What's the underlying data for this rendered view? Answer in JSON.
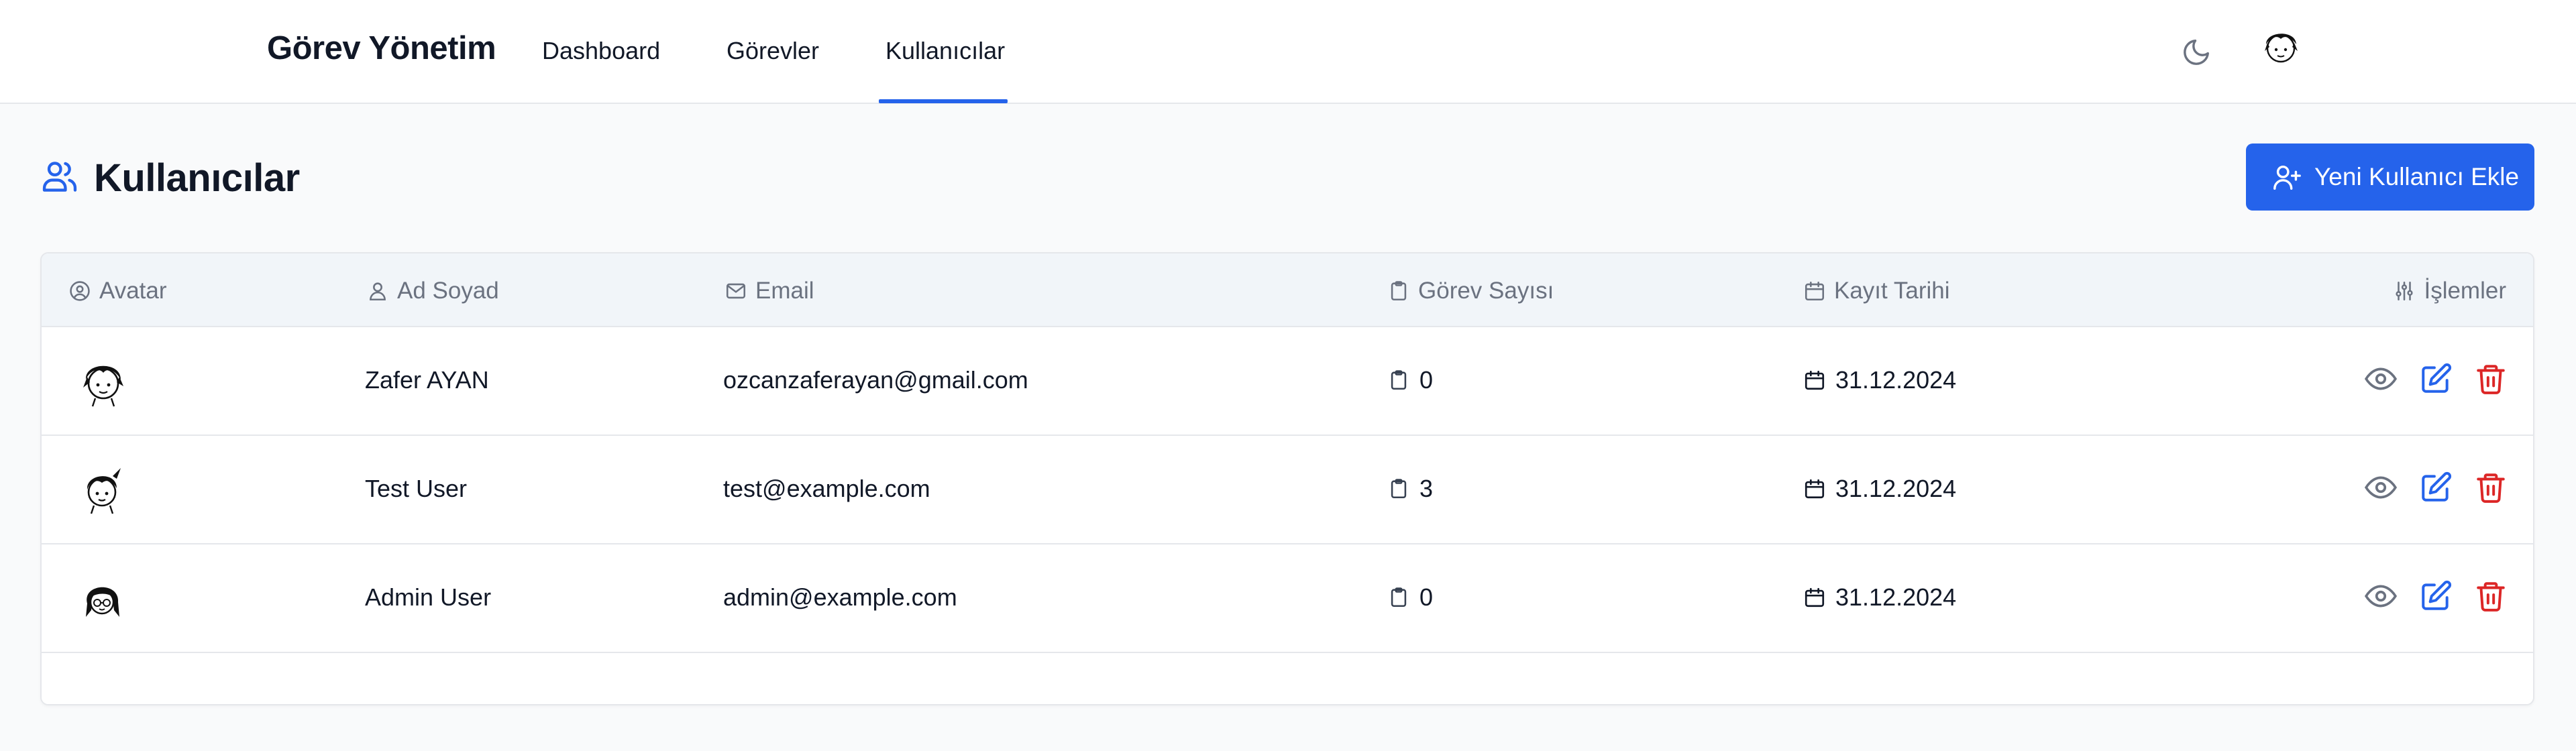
{
  "header": {
    "brand": "Görev Yönetim",
    "nav": {
      "dashboard": "Dashboard",
      "tasks": "Görevler",
      "users": "Kullanıcılar"
    },
    "active_nav": "Kullanıcılar",
    "icons": {
      "theme": "moon-icon",
      "profile": "user-avatar"
    }
  },
  "page": {
    "title": "Kullanıcılar",
    "add_button_label": "Yeni Kullanıcı Ekle"
  },
  "table": {
    "columns": {
      "avatar": "Avatar",
      "name": "Ad Soyad",
      "email": "Email",
      "task_count": "Görev Sayısı",
      "created": "Kayıt Tarihi",
      "actions": "İşlemler"
    },
    "rows": [
      {
        "name": "Zafer AYAN",
        "email": "ozcanzaferayan@gmail.com",
        "task_count": "0",
        "created": "31.12.2024"
      },
      {
        "name": "Test User",
        "email": "test@example.com",
        "task_count": "3",
        "created": "31.12.2024"
      },
      {
        "name": "Admin User",
        "email": "admin@example.com",
        "task_count": "0",
        "created": "31.12.2024"
      }
    ]
  },
  "colors": {
    "accent": "#2563eb",
    "danger": "#dc2626",
    "muted": "#6b7280",
    "header_bg": "#f1f5f9"
  }
}
